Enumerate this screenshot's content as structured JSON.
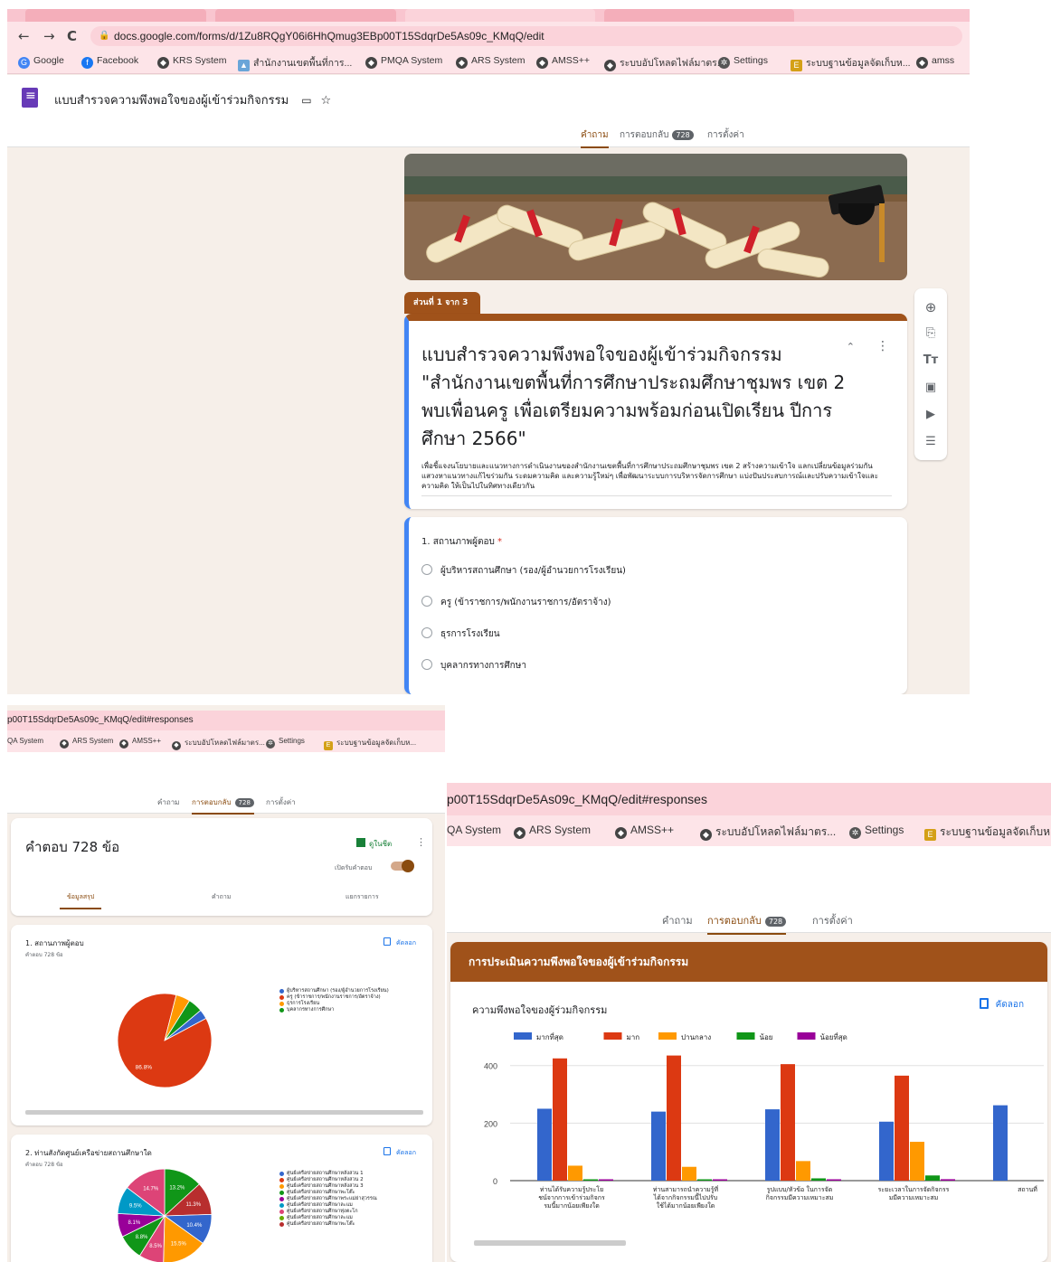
{
  "browser": {
    "url_full": "docs.google.com/forms/d/1Zu8RQgY06i6HhQmug3EBp00T15SdqrDe5As09c_KMqQ/edit",
    "url_tail": "p00T15SdqrDe5As09c_KMqQ/edit#responses",
    "bookmarks": [
      "Google",
      "Facebook",
      "KRS System",
      "สำนักงานเขตพื้นที่การ...",
      "PMQA System",
      "ARS System",
      "AMSS++",
      "ระบบอัปโหลดไฟล์มาตร...",
      "Settings",
      "ระบบฐานข้อมูลจัดเก็บห...",
      "amss"
    ],
    "bookmarks_p2": [
      "QA System",
      "ARS System",
      "AMSS++",
      "ระบบอัปโหลดไฟล์มาตร...",
      "Settings",
      "ระบบฐานข้อมูลจัดเก็บห..."
    ],
    "bookmarks_p3": [
      "QA System",
      "ARS System",
      "AMSS++",
      "ระบบอัปโหลดไฟล์มาตร...",
      "Settings",
      "ระบบฐานข้อมูลจัดเก็บห"
    ]
  },
  "app": {
    "form_name": "แบบสำรวจความพึงพอใจของผู้เข้าร่วมกิจกรรม",
    "tabs": [
      "คำถาม",
      "การตอบกลับ",
      "การตั้งค่า"
    ],
    "response_count": "728"
  },
  "form": {
    "section_tag": "ส่วนที่ 1 จาก 3",
    "title": "แบบสำรวจความพึงพอใจของผู้เข้าร่วมกิจกรรม \"สำนักงานเขตพื้นที่การศึกษาประถมศึกษาชุมพร เขต 2 พบเพื่อนครู เพื่อเตรียมความพร้อมก่อนเปิดเรียน ปีการศึกษา 2566\"",
    "description": "เพื่อชี้แจงนโยบายและแนวทางการดำเนินงานของสำนักงานเขตพื้นที่การศึกษาประถมศึกษาชุมพร เขต 2 สร้างความเข้าใจ แลกเปลี่ยนข้อมูลร่วมกัน แสวงหาแนวทางแก้ไขร่วมกัน ระดมความคิด และความรู้ใหม่ๆ เพื่อพัฒนาระบบการบริหารจัดการศึกษา แบ่งปันประสบการณ์และปรับความเข้าใจและความคิด ให้เป็นไปในทิศทางเดียวกัน",
    "question1": {
      "title": "1. สถานภาพผู้ตอบ",
      "required_mark": "*",
      "options": [
        "ผู้บริหารสถานศึกษา (รอง/ผู้อำนวยการโรงเรียน)",
        "ครู (ข้าราชการ/พนักงานราชการ/อัตราจ้าง)",
        "ธุรการโรงเรียน",
        "บุคลากรทางการศึกษา"
      ]
    }
  },
  "responses": {
    "heading": "คำตอบ 728 ข้อ",
    "sheets_label": "ดูในชีต",
    "accepting_label": "เปิดรับคำตอบ",
    "subtabs": [
      "ข้อมูลสรุป",
      "คำถาม",
      "แยกรายการ"
    ],
    "copy_label": "คัดลอก",
    "q1": {
      "title": "1. สถานภาพผู้ตอบ",
      "subtitle": "คำตอบ 728 ข้อ",
      "legend": [
        "ผู้บริหารสถานศึกษา (รอง/ผู้อำนวยการโรงเรียน)",
        "ครู (ข้าราชการ/พนักงานราชการ/อัตราจ้าง)",
        "ธุรการโรงเรียน",
        "บุคลากรทางการศึกษา"
      ]
    },
    "q2": {
      "title": "2. ท่านสังกัดศูนย์เครือข่ายสถานศึกษาใด",
      "subtitle": "คำตอบ 728 ข้อ",
      "legend": [
        "ศูนย์เครือข่ายสถานศึกษาหลังสวน 1",
        "ศูนย์เครือข่ายสถานศึกษาหลังสวน 2",
        "ศูนย์เครือข่ายสถานศึกษาหลังสวน 3",
        "ศูนย์เครือข่ายสถานศึกษาพะโต๊ะ",
        "ศูนย์เครือข่ายสถานศึกษาพระแม่ย่าสุวรรณ",
        "ศูนย์เครือข่ายสถานศึกษาละแม",
        "ศูนย์เครือข่ายสถานศึกษาทุ่งตะโก",
        "ศูนย์เครือข่ายสถานศึกษาละแม",
        "ศูนย์เครือข่ายสถานศึกษาพะโต๊ะ"
      ]
    },
    "eval_section": "การประเมินความพึงพอใจของผู้เข้าร่วมกิจกรรม",
    "eval_question": "ความพึงพอใจของผู้ร่วมกิจกรรม"
  },
  "chart_data": [
    {
      "type": "pie",
      "labels": [
        "ผู้บริหารสถานศึกษา (รอง/ผู้อำนวยการโรงเรียน)",
        "ครู (ข้าราชการ/พนักงานราชการ/อัตราจ้าง)",
        "ธุรการโรงเรียน",
        "บุคลากรทางการศึกษา"
      ],
      "values": [
        3.3,
        86.8,
        4.9,
        5.0
      ],
      "colors": [
        "#3366cc",
        "#dc3912",
        "#ff9900",
        "#109618"
      ],
      "value_labels": [
        "",
        "86.8%",
        "",
        ""
      ]
    },
    {
      "type": "pie",
      "values": [
        13.2,
        11.3,
        10.4,
        15.5,
        8.5,
        8.8,
        8.1,
        9.5,
        14.7
      ],
      "colors": [
        "#109618",
        "#b82e2e",
        "#3366cc",
        "#ff9900",
        "#dd4477",
        "#109618",
        "#990099",
        "#0099c6",
        "#dd4477"
      ],
      "value_labels": [
        "13.2%",
        "11.3%",
        "10.4%",
        "15.5%",
        "8.5%",
        "8.8%",
        "8.1%",
        "9.5%",
        "14.7%"
      ]
    },
    {
      "type": "bar",
      "categories": [
        "ท่านได้รับความรู้ประโยชน์จากการเข้าร่วมกิจกรรมนี้มากน้อยเพียงใด",
        "ท่านสามารถนำความรู้ที่ได้จากกิจกรรมนี้ไปปรับใช้ได้มากน้อยเพียงใด",
        "รูปแบบ/หัวข้อ ในการจัดกิจกรรมมีความเหมาะสม",
        "ระยะเวลาในการจัดกิจกรรมมีความเหมาะสม",
        "สถานที่"
      ],
      "series": [
        {
          "name": "มากที่สุด",
          "color": "#3366cc",
          "values": [
            250,
            240,
            248,
            205,
            262
          ]
        },
        {
          "name": "มาก",
          "color": "#dc3912",
          "values": [
            425,
            435,
            405,
            365,
            null
          ]
        },
        {
          "name": "ปานกลาง",
          "color": "#ff9900",
          "values": [
            52,
            48,
            68,
            135,
            null
          ]
        },
        {
          "name": "น้อย",
          "color": "#109618",
          "values": [
            2,
            3,
            8,
            18,
            null
          ]
        },
        {
          "name": "น้อยที่สุด",
          "color": "#990099",
          "values": [
            1,
            1,
            2,
            5,
            null
          ]
        }
      ],
      "ylim": [
        0,
        440
      ],
      "yticks": [
        0,
        200,
        400
      ],
      "legend_position": "top-left"
    }
  ]
}
